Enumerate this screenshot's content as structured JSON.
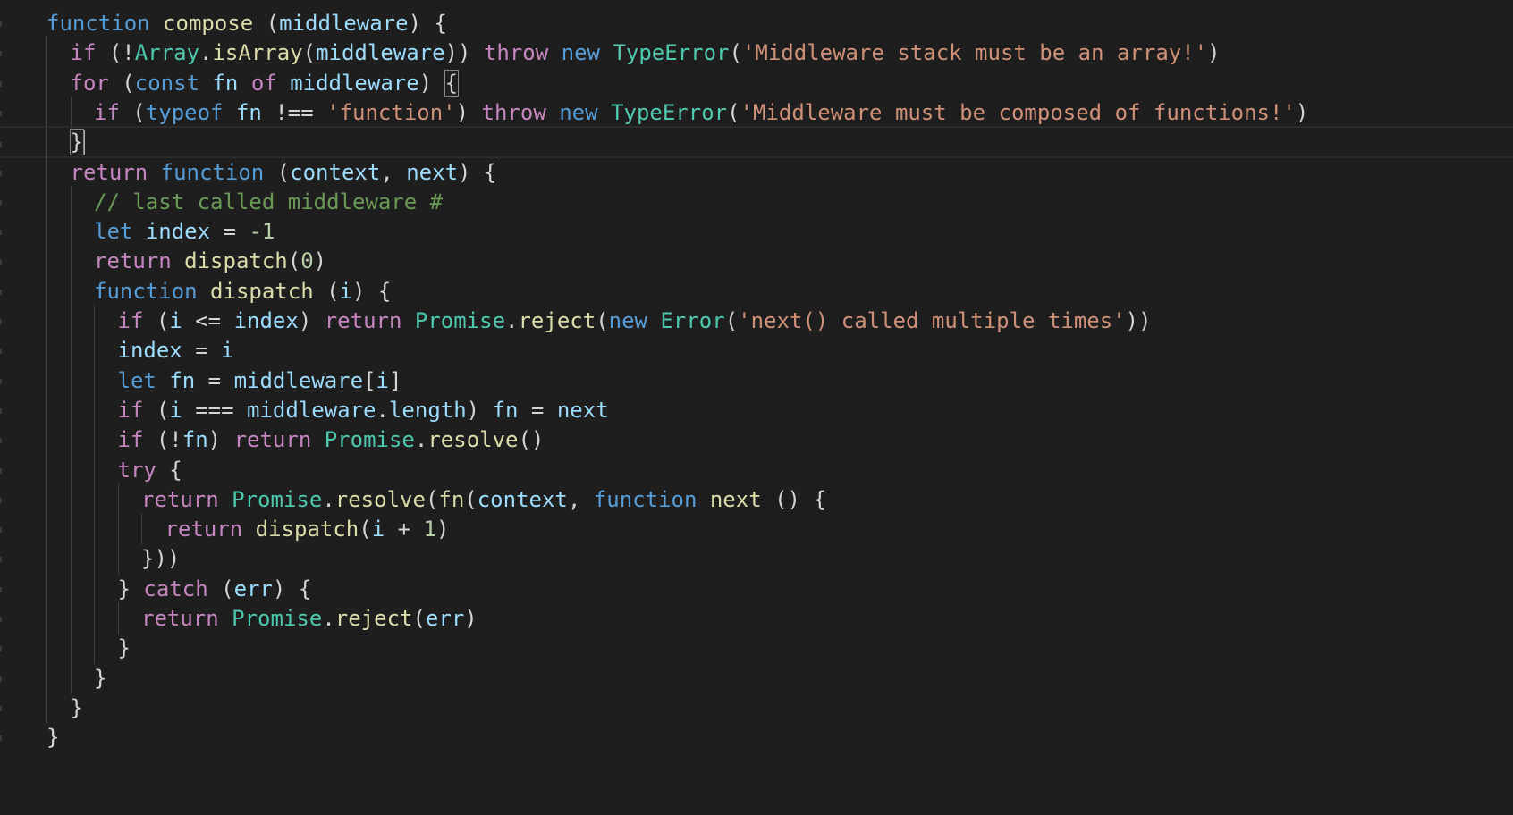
{
  "colors": {
    "background": "#1e1e1e",
    "keyword": "#569cd6",
    "control": "#c586c0",
    "function": "#dcdcaa",
    "variable": "#9cdcfe",
    "class": "#4ec9b0",
    "string": "#ce9178",
    "number": "#b5cea8",
    "comment": "#6a9955",
    "punctuation": "#d4d4d4"
  },
  "editor": {
    "language": "javascript",
    "lines": [
      {
        "indent": 0,
        "tokens": [
          {
            "t": "function",
            "c": "kw"
          },
          {
            "t": " ",
            "c": "pun"
          },
          {
            "t": "compose",
            "c": "fn"
          },
          {
            "t": " (",
            "c": "pun"
          },
          {
            "t": "middleware",
            "c": "var"
          },
          {
            "t": ") {",
            "c": "pun"
          }
        ]
      },
      {
        "indent": 1,
        "tokens": [
          {
            "t": "if",
            "c": "ctrl"
          },
          {
            "t": " (!",
            "c": "pun"
          },
          {
            "t": "Array",
            "c": "cls"
          },
          {
            "t": ".",
            "c": "pun"
          },
          {
            "t": "isArray",
            "c": "fn"
          },
          {
            "t": "(",
            "c": "pun"
          },
          {
            "t": "middleware",
            "c": "var"
          },
          {
            "t": ")) ",
            "c": "pun"
          },
          {
            "t": "throw",
            "c": "ctrl"
          },
          {
            "t": " ",
            "c": "pun"
          },
          {
            "t": "new",
            "c": "kw"
          },
          {
            "t": " ",
            "c": "pun"
          },
          {
            "t": "TypeError",
            "c": "cls"
          },
          {
            "t": "(",
            "c": "pun"
          },
          {
            "t": "'Middleware stack must be an array!'",
            "c": "str"
          },
          {
            "t": ")",
            "c": "pun"
          }
        ]
      },
      {
        "indent": 1,
        "tokens": [
          {
            "t": "for",
            "c": "ctrl"
          },
          {
            "t": " (",
            "c": "pun"
          },
          {
            "t": "const",
            "c": "kw"
          },
          {
            "t": " ",
            "c": "pun"
          },
          {
            "t": "fn",
            "c": "var"
          },
          {
            "t": " ",
            "c": "pun"
          },
          {
            "t": "of",
            "c": "ctrl"
          },
          {
            "t": " ",
            "c": "pun"
          },
          {
            "t": "middleware",
            "c": "var"
          },
          {
            "t": ") ",
            "c": "pun"
          },
          {
            "t": "{",
            "c": "pun",
            "bm": true
          }
        ]
      },
      {
        "indent": 2,
        "tokens": [
          {
            "t": "if",
            "c": "ctrl"
          },
          {
            "t": " (",
            "c": "pun"
          },
          {
            "t": "typeof",
            "c": "kw"
          },
          {
            "t": " ",
            "c": "pun"
          },
          {
            "t": "fn",
            "c": "var"
          },
          {
            "t": " !== ",
            "c": "pun"
          },
          {
            "t": "'function'",
            "c": "str"
          },
          {
            "t": ") ",
            "c": "pun"
          },
          {
            "t": "throw",
            "c": "ctrl"
          },
          {
            "t": " ",
            "c": "pun"
          },
          {
            "t": "new",
            "c": "kw"
          },
          {
            "t": " ",
            "c": "pun"
          },
          {
            "t": "TypeError",
            "c": "cls"
          },
          {
            "t": "(",
            "c": "pun"
          },
          {
            "t": "'Middleware must be composed of functions!'",
            "c": "str"
          },
          {
            "t": ")",
            "c": "pun"
          }
        ]
      },
      {
        "indent": 1,
        "current": true,
        "tokens": [
          {
            "t": "}",
            "c": "pun",
            "bm": true,
            "cursor": true
          }
        ]
      },
      {
        "indent": 1,
        "tokens": [
          {
            "t": "return",
            "c": "ctrl"
          },
          {
            "t": " ",
            "c": "pun"
          },
          {
            "t": "function",
            "c": "kw"
          },
          {
            "t": " (",
            "c": "pun"
          },
          {
            "t": "context",
            "c": "var"
          },
          {
            "t": ", ",
            "c": "pun"
          },
          {
            "t": "next",
            "c": "var"
          },
          {
            "t": ") {",
            "c": "pun"
          }
        ]
      },
      {
        "indent": 2,
        "tokens": [
          {
            "t": "// last called middleware #",
            "c": "cmt"
          }
        ]
      },
      {
        "indent": 2,
        "tokens": [
          {
            "t": "let",
            "c": "kw"
          },
          {
            "t": " ",
            "c": "pun"
          },
          {
            "t": "index",
            "c": "var"
          },
          {
            "t": " = ",
            "c": "pun"
          },
          {
            "t": "-1",
            "c": "num"
          }
        ]
      },
      {
        "indent": 2,
        "tokens": [
          {
            "t": "return",
            "c": "ctrl"
          },
          {
            "t": " ",
            "c": "pun"
          },
          {
            "t": "dispatch",
            "c": "fn"
          },
          {
            "t": "(",
            "c": "pun"
          },
          {
            "t": "0",
            "c": "num"
          },
          {
            "t": ")",
            "c": "pun"
          }
        ]
      },
      {
        "indent": 2,
        "tokens": [
          {
            "t": "function",
            "c": "kw"
          },
          {
            "t": " ",
            "c": "pun"
          },
          {
            "t": "dispatch",
            "c": "fn"
          },
          {
            "t": " (",
            "c": "pun"
          },
          {
            "t": "i",
            "c": "var"
          },
          {
            "t": ") {",
            "c": "pun"
          }
        ]
      },
      {
        "indent": 3,
        "tokens": [
          {
            "t": "if",
            "c": "ctrl"
          },
          {
            "t": " (",
            "c": "pun"
          },
          {
            "t": "i",
            "c": "var"
          },
          {
            "t": " <= ",
            "c": "pun"
          },
          {
            "t": "index",
            "c": "var"
          },
          {
            "t": ") ",
            "c": "pun"
          },
          {
            "t": "return",
            "c": "ctrl"
          },
          {
            "t": " ",
            "c": "pun"
          },
          {
            "t": "Promise",
            "c": "cls"
          },
          {
            "t": ".",
            "c": "pun"
          },
          {
            "t": "reject",
            "c": "fn"
          },
          {
            "t": "(",
            "c": "pun"
          },
          {
            "t": "new",
            "c": "kw"
          },
          {
            "t": " ",
            "c": "pun"
          },
          {
            "t": "Error",
            "c": "cls"
          },
          {
            "t": "(",
            "c": "pun"
          },
          {
            "t": "'next() called multiple times'",
            "c": "str"
          },
          {
            "t": "))",
            "c": "pun"
          }
        ]
      },
      {
        "indent": 3,
        "tokens": [
          {
            "t": "index",
            "c": "var"
          },
          {
            "t": " = ",
            "c": "pun"
          },
          {
            "t": "i",
            "c": "var"
          }
        ]
      },
      {
        "indent": 3,
        "tokens": [
          {
            "t": "let",
            "c": "kw"
          },
          {
            "t": " ",
            "c": "pun"
          },
          {
            "t": "fn",
            "c": "var"
          },
          {
            "t": " = ",
            "c": "pun"
          },
          {
            "t": "middleware",
            "c": "var"
          },
          {
            "t": "[",
            "c": "pun"
          },
          {
            "t": "i",
            "c": "var"
          },
          {
            "t": "]",
            "c": "pun"
          }
        ]
      },
      {
        "indent": 3,
        "tokens": [
          {
            "t": "if",
            "c": "ctrl"
          },
          {
            "t": " (",
            "c": "pun"
          },
          {
            "t": "i",
            "c": "var"
          },
          {
            "t": " === ",
            "c": "pun"
          },
          {
            "t": "middleware",
            "c": "var"
          },
          {
            "t": ".",
            "c": "pun"
          },
          {
            "t": "length",
            "c": "var"
          },
          {
            "t": ") ",
            "c": "pun"
          },
          {
            "t": "fn",
            "c": "var"
          },
          {
            "t": " = ",
            "c": "pun"
          },
          {
            "t": "next",
            "c": "var"
          }
        ]
      },
      {
        "indent": 3,
        "tokens": [
          {
            "t": "if",
            "c": "ctrl"
          },
          {
            "t": " (!",
            "c": "pun"
          },
          {
            "t": "fn",
            "c": "var"
          },
          {
            "t": ") ",
            "c": "pun"
          },
          {
            "t": "return",
            "c": "ctrl"
          },
          {
            "t": " ",
            "c": "pun"
          },
          {
            "t": "Promise",
            "c": "cls"
          },
          {
            "t": ".",
            "c": "pun"
          },
          {
            "t": "resolve",
            "c": "fn"
          },
          {
            "t": "()",
            "c": "pun"
          }
        ]
      },
      {
        "indent": 3,
        "tokens": [
          {
            "t": "try",
            "c": "ctrl"
          },
          {
            "t": " {",
            "c": "pun"
          }
        ]
      },
      {
        "indent": 4,
        "tokens": [
          {
            "t": "return",
            "c": "ctrl"
          },
          {
            "t": " ",
            "c": "pun"
          },
          {
            "t": "Promise",
            "c": "cls"
          },
          {
            "t": ".",
            "c": "pun"
          },
          {
            "t": "resolve",
            "c": "fn"
          },
          {
            "t": "(",
            "c": "pun"
          },
          {
            "t": "fn",
            "c": "fn"
          },
          {
            "t": "(",
            "c": "pun"
          },
          {
            "t": "context",
            "c": "var"
          },
          {
            "t": ", ",
            "c": "pun"
          },
          {
            "t": "function",
            "c": "kw"
          },
          {
            "t": " ",
            "c": "pun"
          },
          {
            "t": "next",
            "c": "fn"
          },
          {
            "t": " () {",
            "c": "pun"
          }
        ]
      },
      {
        "indent": 5,
        "tokens": [
          {
            "t": "return",
            "c": "ctrl"
          },
          {
            "t": " ",
            "c": "pun"
          },
          {
            "t": "dispatch",
            "c": "fn"
          },
          {
            "t": "(",
            "c": "pun"
          },
          {
            "t": "i",
            "c": "var"
          },
          {
            "t": " + ",
            "c": "pun"
          },
          {
            "t": "1",
            "c": "num"
          },
          {
            "t": ")",
            "c": "pun"
          }
        ]
      },
      {
        "indent": 4,
        "tokens": [
          {
            "t": "}))",
            "c": "pun"
          }
        ]
      },
      {
        "indent": 3,
        "tokens": [
          {
            "t": "} ",
            "c": "pun"
          },
          {
            "t": "catch",
            "c": "ctrl"
          },
          {
            "t": " (",
            "c": "pun"
          },
          {
            "t": "err",
            "c": "var"
          },
          {
            "t": ") {",
            "c": "pun"
          }
        ]
      },
      {
        "indent": 4,
        "tokens": [
          {
            "t": "return",
            "c": "ctrl"
          },
          {
            "t": " ",
            "c": "pun"
          },
          {
            "t": "Promise",
            "c": "cls"
          },
          {
            "t": ".",
            "c": "pun"
          },
          {
            "t": "reject",
            "c": "fn"
          },
          {
            "t": "(",
            "c": "pun"
          },
          {
            "t": "err",
            "c": "var"
          },
          {
            "t": ")",
            "c": "pun"
          }
        ]
      },
      {
        "indent": 3,
        "tokens": [
          {
            "t": "}",
            "c": "pun"
          }
        ]
      },
      {
        "indent": 2,
        "tokens": [
          {
            "t": "}",
            "c": "pun"
          }
        ]
      },
      {
        "indent": 1,
        "tokens": [
          {
            "t": "}",
            "c": "pun"
          }
        ]
      },
      {
        "indent": 0,
        "tokens": [
          {
            "t": "}",
            "c": "pun"
          }
        ]
      }
    ]
  }
}
